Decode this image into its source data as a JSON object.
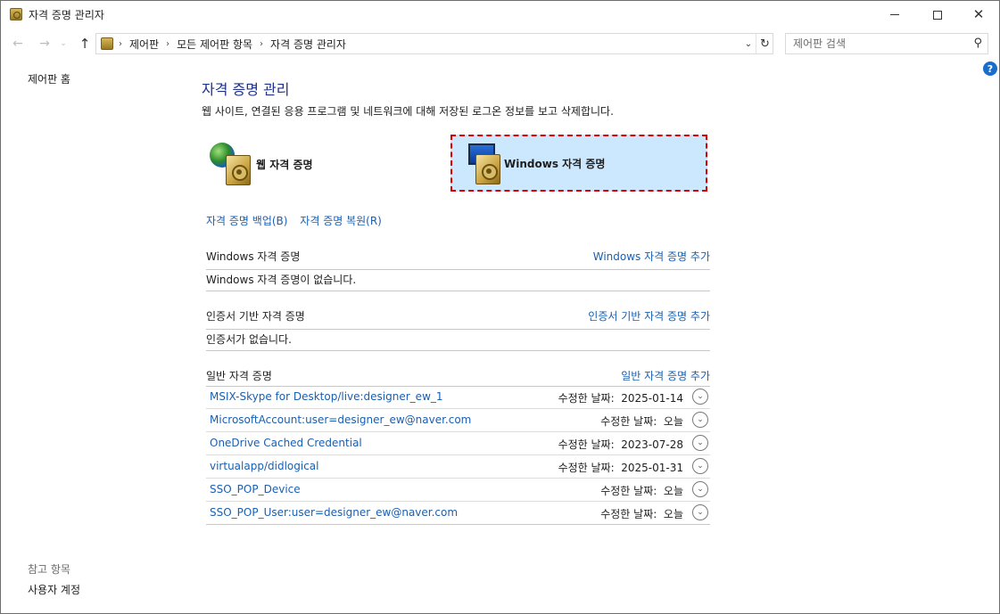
{
  "window": {
    "title": "자격 증명 관리자"
  },
  "nav": {
    "breadcrumbs": [
      "제어판",
      "모든 제어판 항목",
      "자격 증명 관리자"
    ],
    "search_placeholder": "제어판 검색"
  },
  "left": {
    "home": "제어판 홈",
    "see_also": "참고 항목",
    "user_accounts": "사용자 계정"
  },
  "main": {
    "title": "자격 증명 관리",
    "description": "웹 사이트, 연결된 응용 프로그램 및 네트워크에 대해 저장된 로그온 정보를 보고 삭제합니다.",
    "tiles": {
      "web": "웹 자격 증명",
      "windows": "Windows 자격 증명"
    },
    "backup": "자격 증명 백업(B)",
    "restore": "자격 증명 복원(R)"
  },
  "sections": {
    "windows": {
      "name": "Windows 자격 증명",
      "add": "Windows 자격 증명 추가",
      "empty": "Windows 자격 증명이 없습니다."
    },
    "cert": {
      "name": "인증서 기반 자격 증명",
      "add": "인증서 기반 자격 증명 추가",
      "empty": "인증서가 없습니다."
    },
    "generic": {
      "name": "일반 자격 증명",
      "add": "일반 자격 증명 추가"
    }
  },
  "generic_credentials": [
    {
      "name": "MSIX-Skype for Desktop/live:designer_ew_1",
      "modified": "수정한 날짜:  2025-01-14"
    },
    {
      "name": "MicrosoftAccount:user=designer_ew@naver.com",
      "modified": "수정한 날짜:  오늘"
    },
    {
      "name": "OneDrive Cached Credential",
      "modified": "수정한 날짜:  2023-07-28"
    },
    {
      "name": "virtualapp/didlogical",
      "modified": "수정한 날짜:  2025-01-31"
    },
    {
      "name": "SSO_POP_Device",
      "modified": "수정한 날짜:  오늘"
    },
    {
      "name": "SSO_POP_User:user=designer_ew@naver.com",
      "modified": "수정한 날짜:  오늘"
    }
  ],
  "colors": {
    "accent_link": "#1a5fb0",
    "title_blue": "#1e3287",
    "selected_tile": "#cce8ff",
    "highlight_border": "#e00000"
  }
}
